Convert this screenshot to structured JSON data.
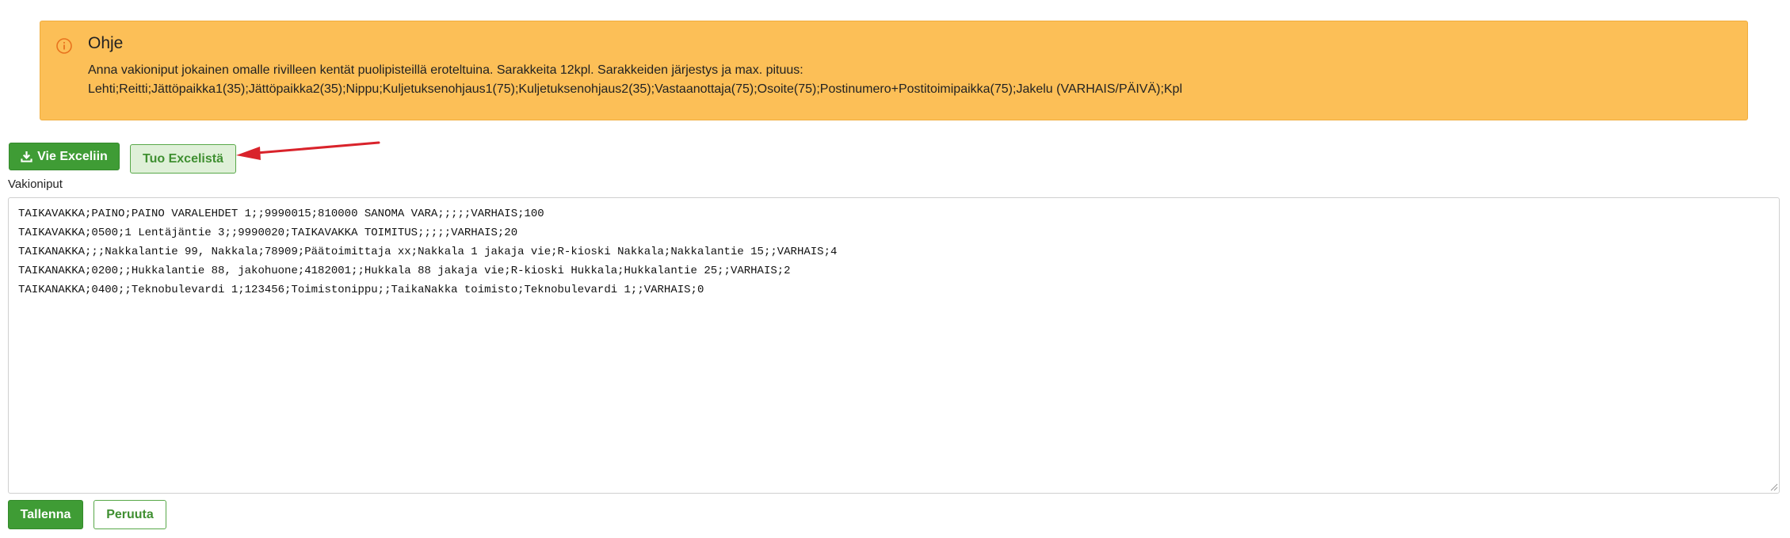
{
  "info": {
    "title": "Ohje",
    "line1": "Anna vakioniput jokainen omalle rivilleen kentät puolipisteillä eroteltuina. Sarakkeita 12kpl. Sarakkeiden järjestys ja max. pituus:",
    "line2": "Lehti;Reitti;Jättöpaikka1(35);Jättöpaikka2(35);Nippu;Kuljetuksenohjaus1(75);Kuljetuksenohjaus2(35);Vastaanottaja(75);Osoite(75);Postinumero+Postitoimipaikka(75);Jakelu (VARHAIS/PÄIVÄ);Kpl",
    "icon": "info-circle-icon",
    "background_color": "#fcbf57"
  },
  "toolbar": {
    "export_label": "Vie Exceliin",
    "import_label": "Tuo Excelistä",
    "export_icon": "download-icon"
  },
  "field": {
    "label": "Vakioniput",
    "value": "TAIKAVAKKA;PAINO;PAINO VARALEHDET 1;;9990015;810000 SANOMA VARA;;;;;VARHAIS;100\nTAIKAVAKKA;0500;1 Lentäjäntie 3;;9990020;TAIKAVAKKA TOIMITUS;;;;;VARHAIS;20\nTAIKANAKKA;;;Nakkalantie 99, Nakkala;78909;Päätoimittaja xx;Nakkala 1 jakaja vie;R-kioski Nakkala;Nakkalantie 15;;VARHAIS;4\nTAIKANAKKA;0200;;Hukkalantie 88, jakohuone;4182001;;Hukkala 88 jakaja vie;R-kioski Hukkala;Hukkalantie 25;;VARHAIS;2\nTAIKANAKKA;0400;;Teknobulevardi 1;123456;Toimistonippu;;TaikaNakka toimisto;Teknobulevardi 1;;VARHAIS;0"
  },
  "actions": {
    "save_label": "Tallenna",
    "cancel_label": "Peruuta"
  },
  "colors": {
    "primary_green": "#3f9c35",
    "light_green": "#dff0d8",
    "annotation_arrow": "#d9232b"
  }
}
